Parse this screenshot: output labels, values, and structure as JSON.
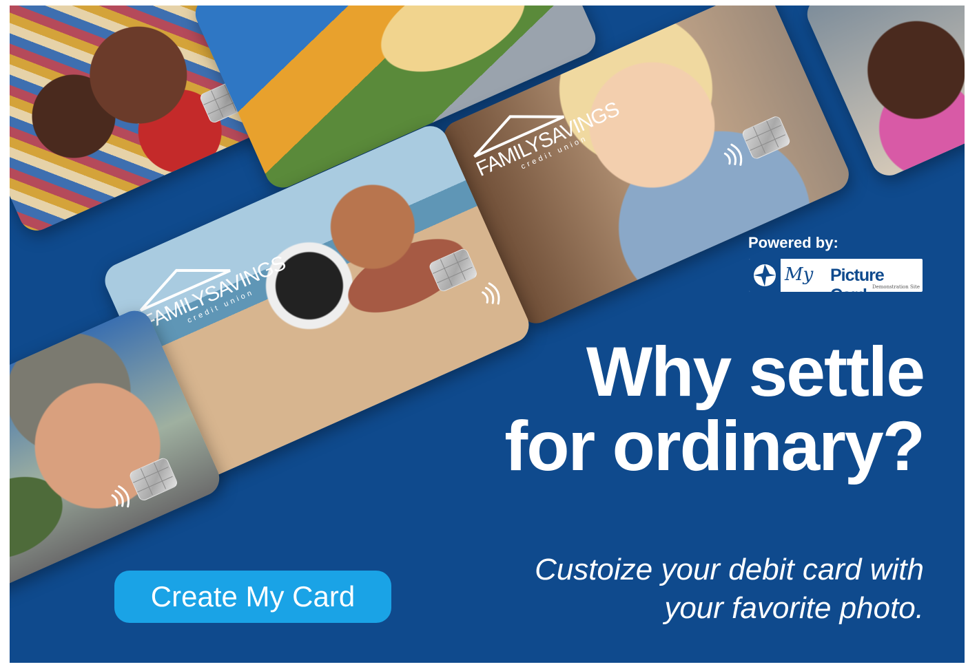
{
  "cards": {
    "brand_name": "FAMILYSAVINGS",
    "brand_sub": "credit union"
  },
  "powered_by": {
    "label": "Powered by:",
    "logo_script": "My",
    "logo_word": "Picture Card",
    "logo_caption": "Demonstration Site"
  },
  "headline": {
    "line1": "Why settle",
    "line2": "for ordinary?"
  },
  "subline": {
    "line1": "Custoize your debit card with",
    "line2": "your favorite photo."
  },
  "cta": {
    "label": "Create My Card"
  },
  "colors": {
    "background": "#0f4a8d",
    "button": "#1aa3e6",
    "text": "#ffffff"
  }
}
